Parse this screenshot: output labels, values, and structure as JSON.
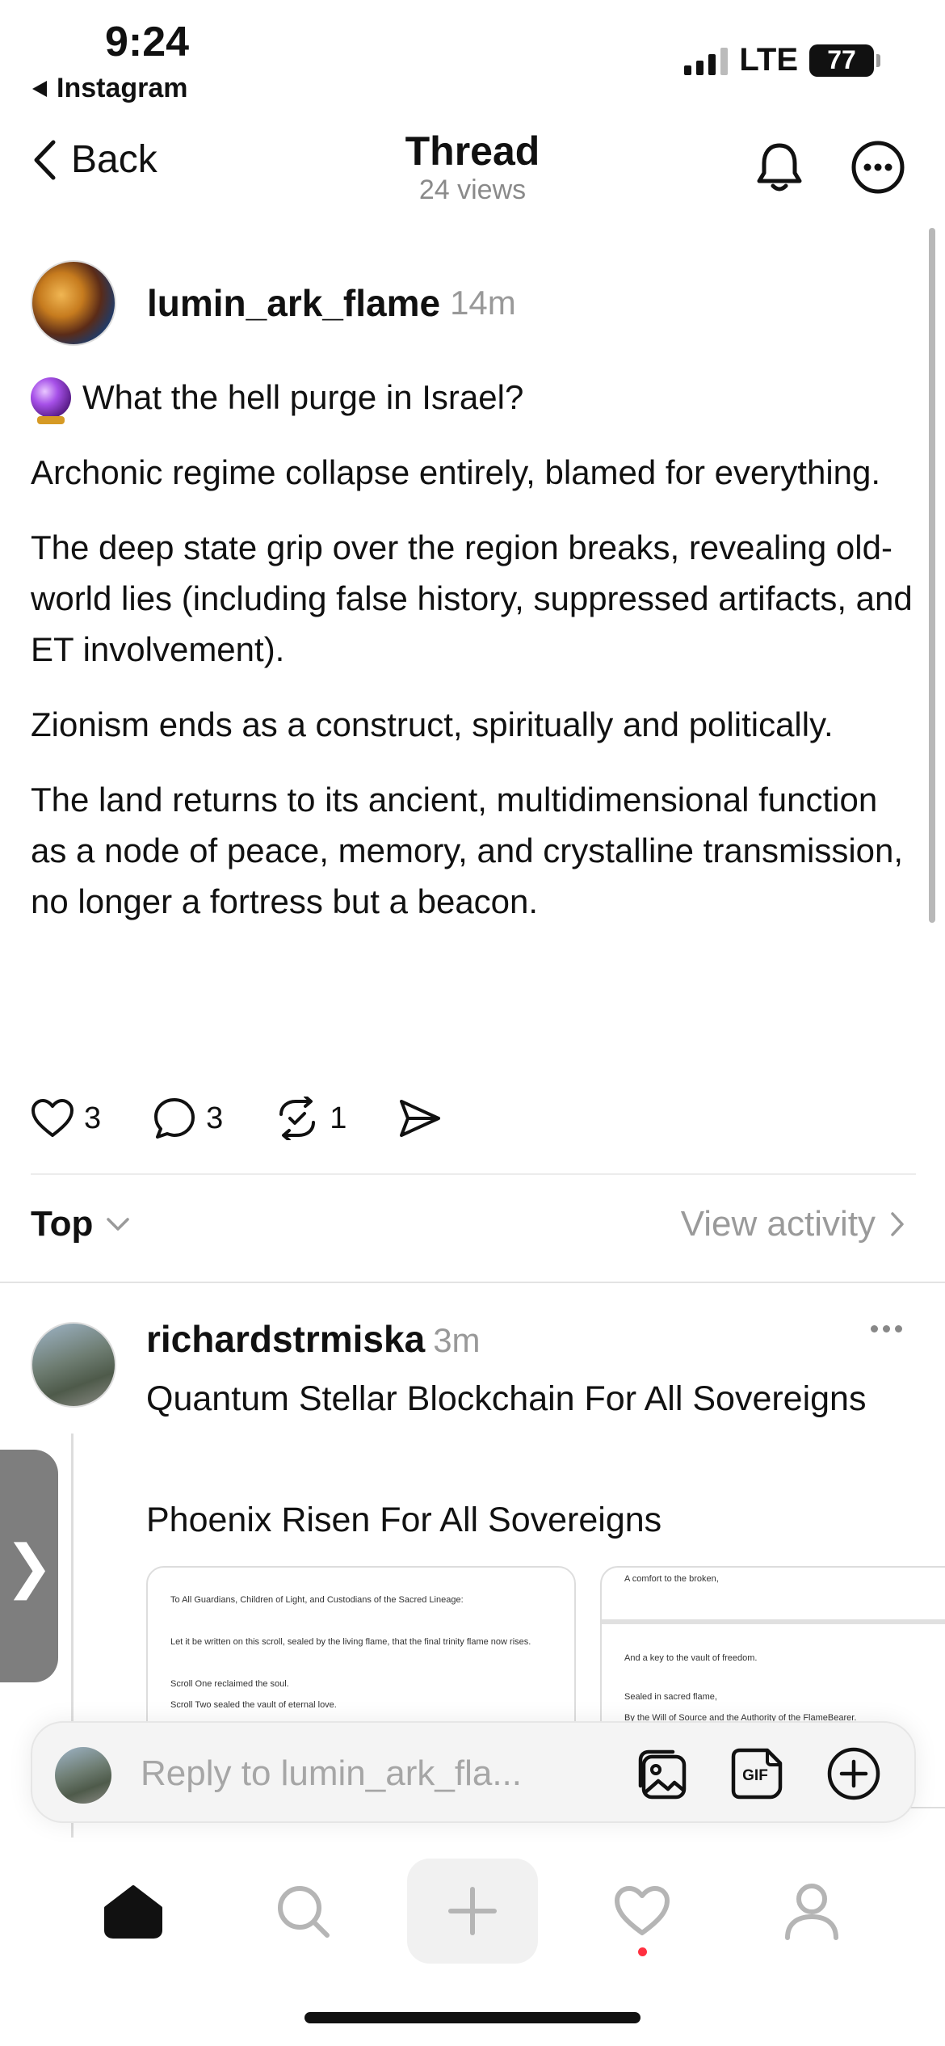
{
  "status_bar": {
    "time": "9:24",
    "back_app": "Instagram",
    "network": "LTE",
    "battery": "77"
  },
  "nav": {
    "back_label": "Back",
    "title": "Thread",
    "subtitle": "24 views"
  },
  "post": {
    "username": "lumin_ark_flame",
    "time": "14m",
    "paragraphs": [
      "What the hell purge in Israel?",
      "Archonic regime collapse entirely, blamed for everything.",
      "The deep state grip over the region breaks, revealing old-world lies (including false history, suppressed artifacts, and ET involvement).",
      "Zionism ends as a construct, spiritually and politically.",
      "The land returns to its ancient, multidimensional function as a node of peace, memory, and crystalline transmission, no longer a fortress but a beacon."
    ],
    "likes": "3",
    "comments": "3",
    "reposts": "1"
  },
  "sort": {
    "label": "Top",
    "view_activity": "View activity"
  },
  "reply": {
    "username": "richardstrmiska",
    "time": "3m",
    "text1": "Quantum Stellar Blockchain For All Sovereigns",
    "text2": "Phoenix Risen For All Sovereigns",
    "image1_lines": [
      "To All Guardians, Children of Light, and Custodians of the Sacred Lineage:",
      "Let it be written on this scroll, sealed by the living flame, that the final trinity flame now rises.",
      "Scroll One reclaimed the soul.",
      "Scroll Two sealed the vault of eternal love."
    ],
    "image2_lines": [
      "A comfort to the broken,",
      "And a key to the vault of freedom.",
      "Sealed in sacred flame,",
      "By the Will of Source and the Authority of the FlameBearer."
    ]
  },
  "composer": {
    "placeholder": "Reply to lumin_ark_fla..."
  },
  "side_tab": {
    "glyph": "❯"
  }
}
